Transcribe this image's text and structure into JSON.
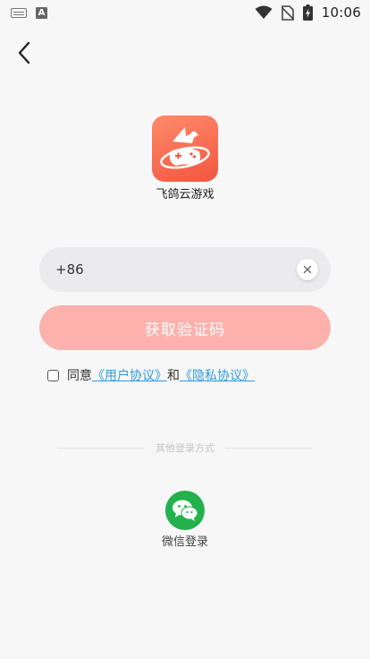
{
  "status_bar": {
    "time": "10:06",
    "icons": [
      "keyboard-icon",
      "a-notification-icon",
      "wifi-icon",
      "no-sim-icon",
      "battery-charging-icon"
    ]
  },
  "header": {
    "back_icon": "chevron-left-icon"
  },
  "app": {
    "name": "飞鸽云游戏",
    "logo_icon": "pigeon-planet-gamepad-logo"
  },
  "login": {
    "country_code": "+86",
    "phone_value": "",
    "phone_placeholder": "",
    "clear_icon": "close-icon",
    "get_code_label": "获取验证码",
    "agree_prefix": "同意",
    "user_agreement": "《用户协议》",
    "agree_and": "和",
    "privacy_agreement": "《隐私协议》"
  },
  "other_login": {
    "title": "其他登录方式",
    "wechat_label": "微信登录",
    "wechat_icon": "wechat-icon"
  },
  "colors": {
    "accent": "#f2563f",
    "button_disabled": "#fdb1ad",
    "link": "#2b9be0",
    "wechat": "#22b14c",
    "background": "#f7f7f8"
  }
}
